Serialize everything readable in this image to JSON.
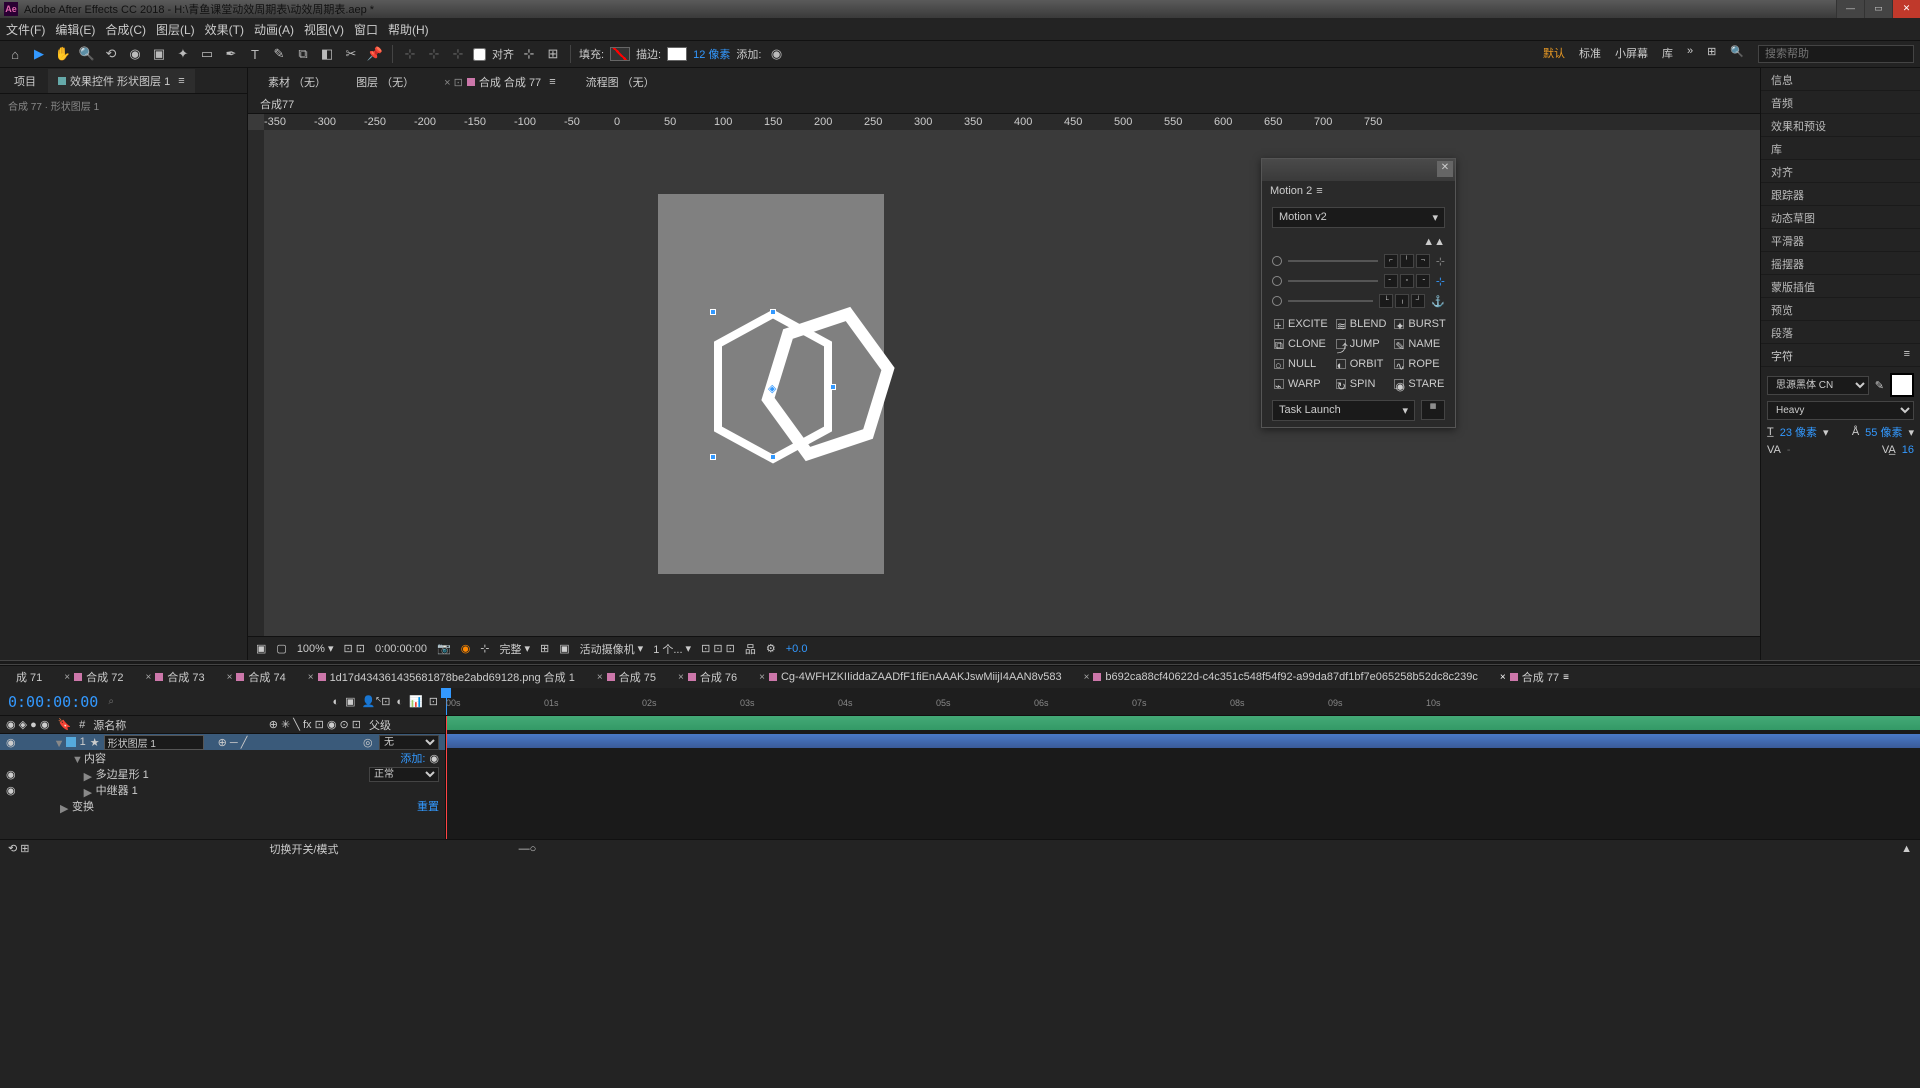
{
  "title": "Adobe After Effects CC 2018 - H:\\青鱼课堂动效周期表\\动效周期表.aep *",
  "menu": [
    "文件(F)",
    "编辑(E)",
    "合成(C)",
    "图层(L)",
    "效果(T)",
    "动画(A)",
    "视图(V)",
    "窗口",
    "帮助(H)"
  ],
  "toolbar": {
    "align": "对齐",
    "fill_lbl": "填充:",
    "stroke_lbl": "描边:",
    "stroke_val": "12 像素",
    "add_lbl": "添加:",
    "workspaces": [
      "默认",
      "标准",
      "小屏幕",
      "库"
    ],
    "search_ph": "搜索帮助"
  },
  "left_panel": {
    "tabs": [
      "项目",
      "效果控件 形状图层 1"
    ],
    "sub": "合成 77 · 形状图层 1"
  },
  "center": {
    "tabs": [
      {
        "label": "素材 （无）"
      },
      {
        "label": "图层 （无）"
      },
      {
        "label": "合成 合成 77",
        "active": true
      },
      {
        "label": "流程图 （无）"
      }
    ],
    "subtab": "合成77",
    "ruler_ticks": [
      "-350",
      "-300",
      "-250",
      "-200",
      "-150",
      "-100",
      "-50",
      "0",
      "50",
      "100",
      "150",
      "200",
      "250",
      "300",
      "350",
      "400",
      "450",
      "500",
      "550",
      "600",
      "650",
      "700",
      "750"
    ]
  },
  "viewport_footer": {
    "zoom": "100%",
    "time": "0:00:00:00",
    "res": "完整",
    "camera": "活动摄像机",
    "views": "1 个...",
    "exp": "+0.0"
  },
  "right_panel": {
    "items": [
      "信息",
      "音频",
      "效果和预设",
      "库",
      "对齐",
      "跟踪器",
      "动态草图",
      "平滑器",
      "摇摆器",
      "蒙版插值",
      "预览",
      "段落",
      "字符"
    ],
    "font": "思源黑体 CN",
    "weight": "Heavy",
    "size_lbl": "23 像素",
    "lead_lbl": "55 像素",
    "tracking": "16"
  },
  "motion": {
    "title": "Motion 2",
    "preset": "Motion v2",
    "actions": [
      "EXCITE",
      "BLEND",
      "BURST",
      "CLONE",
      "JUMP",
      "NAME",
      "NULL",
      "ORBIT",
      "ROPE",
      "WARP",
      "SPIN",
      "STARE"
    ],
    "task": "Task Launch"
  },
  "timeline": {
    "tabs": [
      "成 71",
      "合成 72",
      "合成 73",
      "合成 74",
      "1d17d434361435681878be2abd69128.png 合成 1",
      "合成 75",
      "合成 76",
      "Cg-4WFHZKIIiddaZAADfF1fiEnAAAKJswMiijI4AAN8v583",
      "b692ca88cf40622d-c4c351c548f54f92-a99da87df1bf7e065258b52dc8c239c",
      "合成 77"
    ],
    "timecode": "0:00:00:00",
    "search_ph": "⌕",
    "col_src": "源名称",
    "col_parent": "父级",
    "ticks": [
      "00s",
      "01s",
      "02s",
      "03s",
      "04s",
      "05s",
      "06s",
      "07s",
      "08s",
      "09s",
      "10s"
    ],
    "layers": [
      {
        "num": "1",
        "name": "形状图层 1",
        "mode": "",
        "parent": "无",
        "selected": true
      },
      {
        "name": "内容",
        "add": "添加:"
      },
      {
        "name": "多边星形 1",
        "mode": "正常"
      },
      {
        "name": "中继器 1"
      },
      {
        "name": "变换",
        "reset": "重置"
      }
    ],
    "footer_left": "⟲ ⊞",
    "footer_mid": "切换开关/模式"
  }
}
